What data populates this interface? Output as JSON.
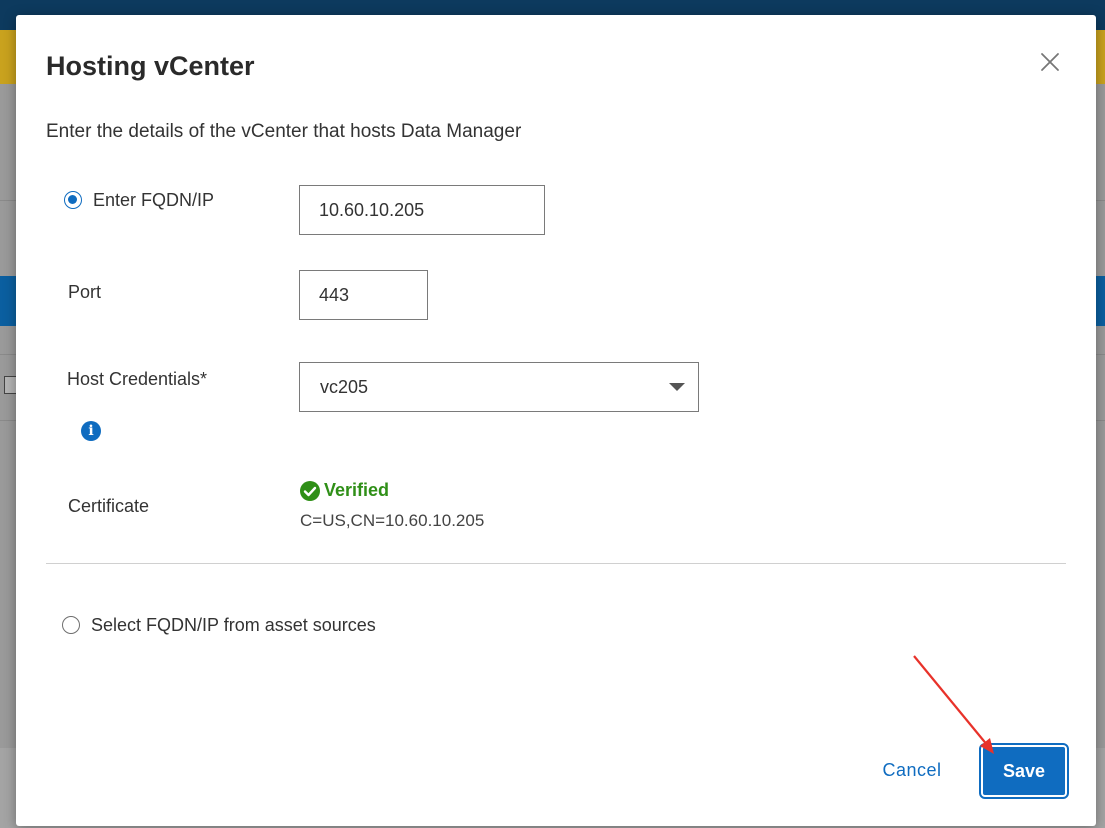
{
  "dialog": {
    "title": "Hosting vCenter",
    "subtitle": "Enter the details of the vCenter that hosts Data Manager",
    "close_icon": "close-icon"
  },
  "form": {
    "fqdn_option_label": "Enter FQDN/IP",
    "fqdn_value": "10.60.10.205",
    "port_label": "Port",
    "port_value": "443",
    "credentials_label": "Host Credentials*",
    "credentials_selected": "vc205",
    "certificate_label": "Certificate",
    "certificate_status": "Verified",
    "certificate_value": "C=US,CN=10.60.10.205",
    "asset_option_label": "Select FQDN/IP from asset sources"
  },
  "footer": {
    "cancel_label": "Cancel",
    "save_label": "Save"
  },
  "colors": {
    "accent": "#0f6cc0",
    "success": "#2f8f17",
    "annotation_arrow": "#e8322a"
  }
}
